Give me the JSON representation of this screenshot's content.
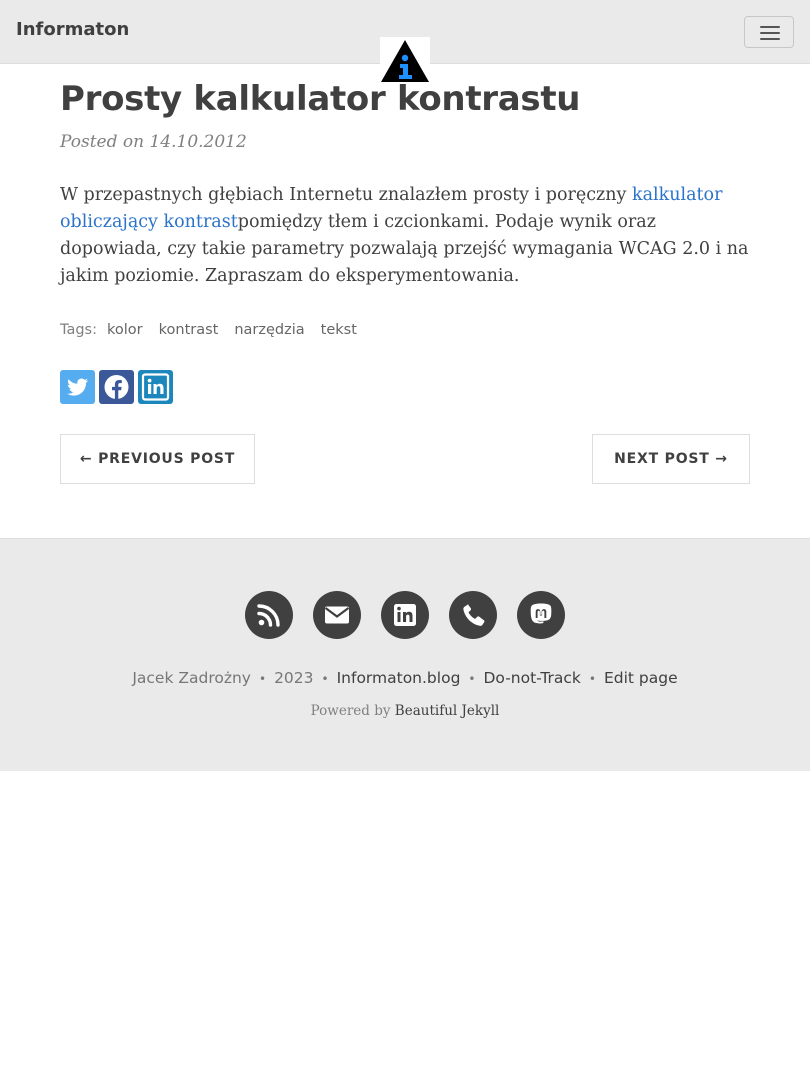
{
  "header": {
    "brand": "Informaton",
    "logo_icon": "informaton-triangle-logo-icon",
    "menu_icon": "hamburger-menu-icon"
  },
  "post": {
    "title": "Prosty kalkulator kontrastu",
    "posted_on": "Posted on 14.10.2012",
    "body_before_link": "W przepastnych głębiach Internetu znalazłem prosty i poręczny ",
    "link_text": "kalkulator obliczający kontrast",
    "body_after_link": "pomiędzy tłem i czcionkami. Podaje wynik oraz dopowiada, czy takie parametry pozwalają przejść wymagania WCAG 2.0 i na jakim poziomie. Zapraszam do eksperymentowania.",
    "tags_label": "Tags:",
    "tags": [
      "kolor",
      "kontrast",
      "narzędzia",
      "tekst"
    ]
  },
  "share": {
    "icons": [
      "twitter-icon",
      "facebook-icon",
      "linkedin-icon"
    ]
  },
  "pager": {
    "previous": "← PREVIOUS POST",
    "next": "NEXT POST →"
  },
  "footer": {
    "icons": [
      "rss-icon",
      "envelope-icon",
      "linkedin-icon",
      "phone-icon",
      "mastodon-icon"
    ],
    "author": "Jacek Zadrożny",
    "sep": "•",
    "year": "2023",
    "blog_link": "Informaton.blog",
    "dnt_link": "Do-not-Track",
    "edit_link": "Edit page",
    "powered_by": "Powered by",
    "powered_link": "Beautiful Jekyll"
  },
  "colors": {
    "link": "#2a73c9",
    "nav_bg": "#eaeaea",
    "twitter": "#55acee",
    "facebook": "#3b5998",
    "linkedin": "#1c87bd",
    "logo_blue": "#1e90ff"
  }
}
